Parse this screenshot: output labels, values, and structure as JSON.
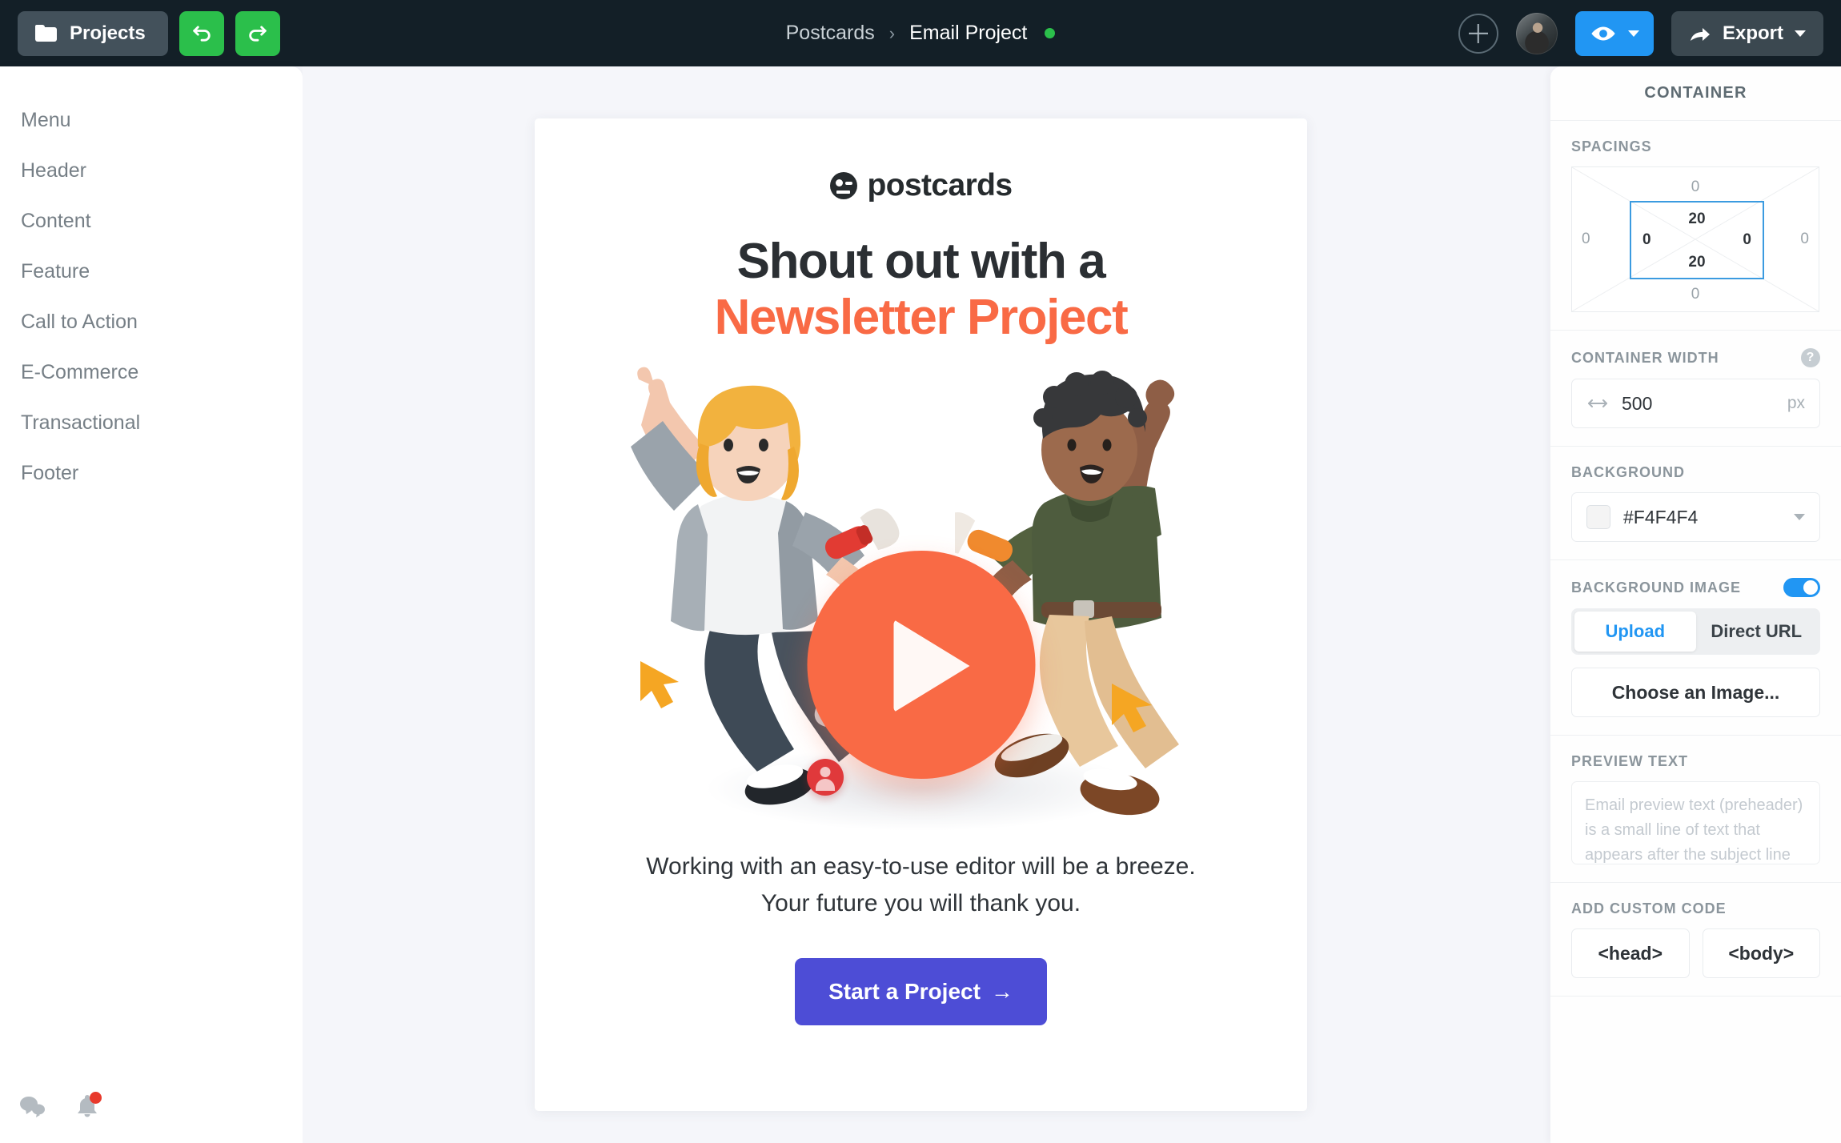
{
  "topbar": {
    "projects_label": "Projects",
    "undo_icon": "undo-icon",
    "redo_icon": "redo-icon",
    "breadcrumb": {
      "root": "Postcards",
      "separator": "›",
      "current": "Email Project",
      "status_dot_color": "#2BBF4B"
    },
    "add_icon": "plus-icon",
    "avatar_name": "user-avatar",
    "preview_icon": "eye-icon",
    "export_label": "Export",
    "export_icon": "share-arrow-icon",
    "bg": "#131F27",
    "accent_green": "#2BBF4B",
    "accent_blue": "#2196F3"
  },
  "sidebar": {
    "items": [
      {
        "label": "Menu"
      },
      {
        "label": "Header"
      },
      {
        "label": "Content"
      },
      {
        "label": "Feature"
      },
      {
        "label": "Call to Action"
      },
      {
        "label": "E-Commerce"
      },
      {
        "label": "Transactional"
      },
      {
        "label": "Footer"
      }
    ],
    "bottom_icons": [
      {
        "name": "chat-icon"
      },
      {
        "name": "bell-icon",
        "badge": true
      }
    ]
  },
  "email": {
    "logo_text": "postcards",
    "headline_line1": "Shout out with a",
    "headline_line2": "Newsletter Project",
    "headline_color_1": "#2B2F33",
    "headline_color_2": "#F96A45",
    "play_button": "play-icon",
    "body_text": "Working with an easy-to-use editor will be a breeze. Your future you will thank you.",
    "cta_label": "Start a Project",
    "cta_arrow": "→",
    "cta_color": "#4D4DD6"
  },
  "panel": {
    "title": "CONTAINER",
    "spacings": {
      "label": "SPACINGS",
      "margin_top": "0",
      "margin_right": "0",
      "margin_bottom": "0",
      "margin_left": "0",
      "padding_top": "20",
      "padding_right": "0",
      "padding_bottom": "20",
      "padding_left": "0",
      "highlight_color": "#3B9BE0"
    },
    "container_width": {
      "label": "CONTAINER WIDTH",
      "value": "500",
      "unit": "px",
      "help": "?"
    },
    "background": {
      "label": "BACKGROUND",
      "value": "#F4F4F4",
      "swatch": "#F4F4F4"
    },
    "background_image": {
      "label": "BACKGROUND IMAGE",
      "enabled": true,
      "tabs": [
        {
          "label": "Upload",
          "selected": true
        },
        {
          "label": "Direct URL",
          "selected": false
        }
      ],
      "choose_label": "Choose an Image..."
    },
    "preview_text": {
      "label": "PREVIEW TEXT",
      "placeholder": "Email preview text (preheader) is a small line of text that appears after the subject line in the inbox."
    },
    "custom_code": {
      "label": "ADD CUSTOM CODE",
      "head_label": "<head>",
      "body_label": "<body>"
    }
  }
}
